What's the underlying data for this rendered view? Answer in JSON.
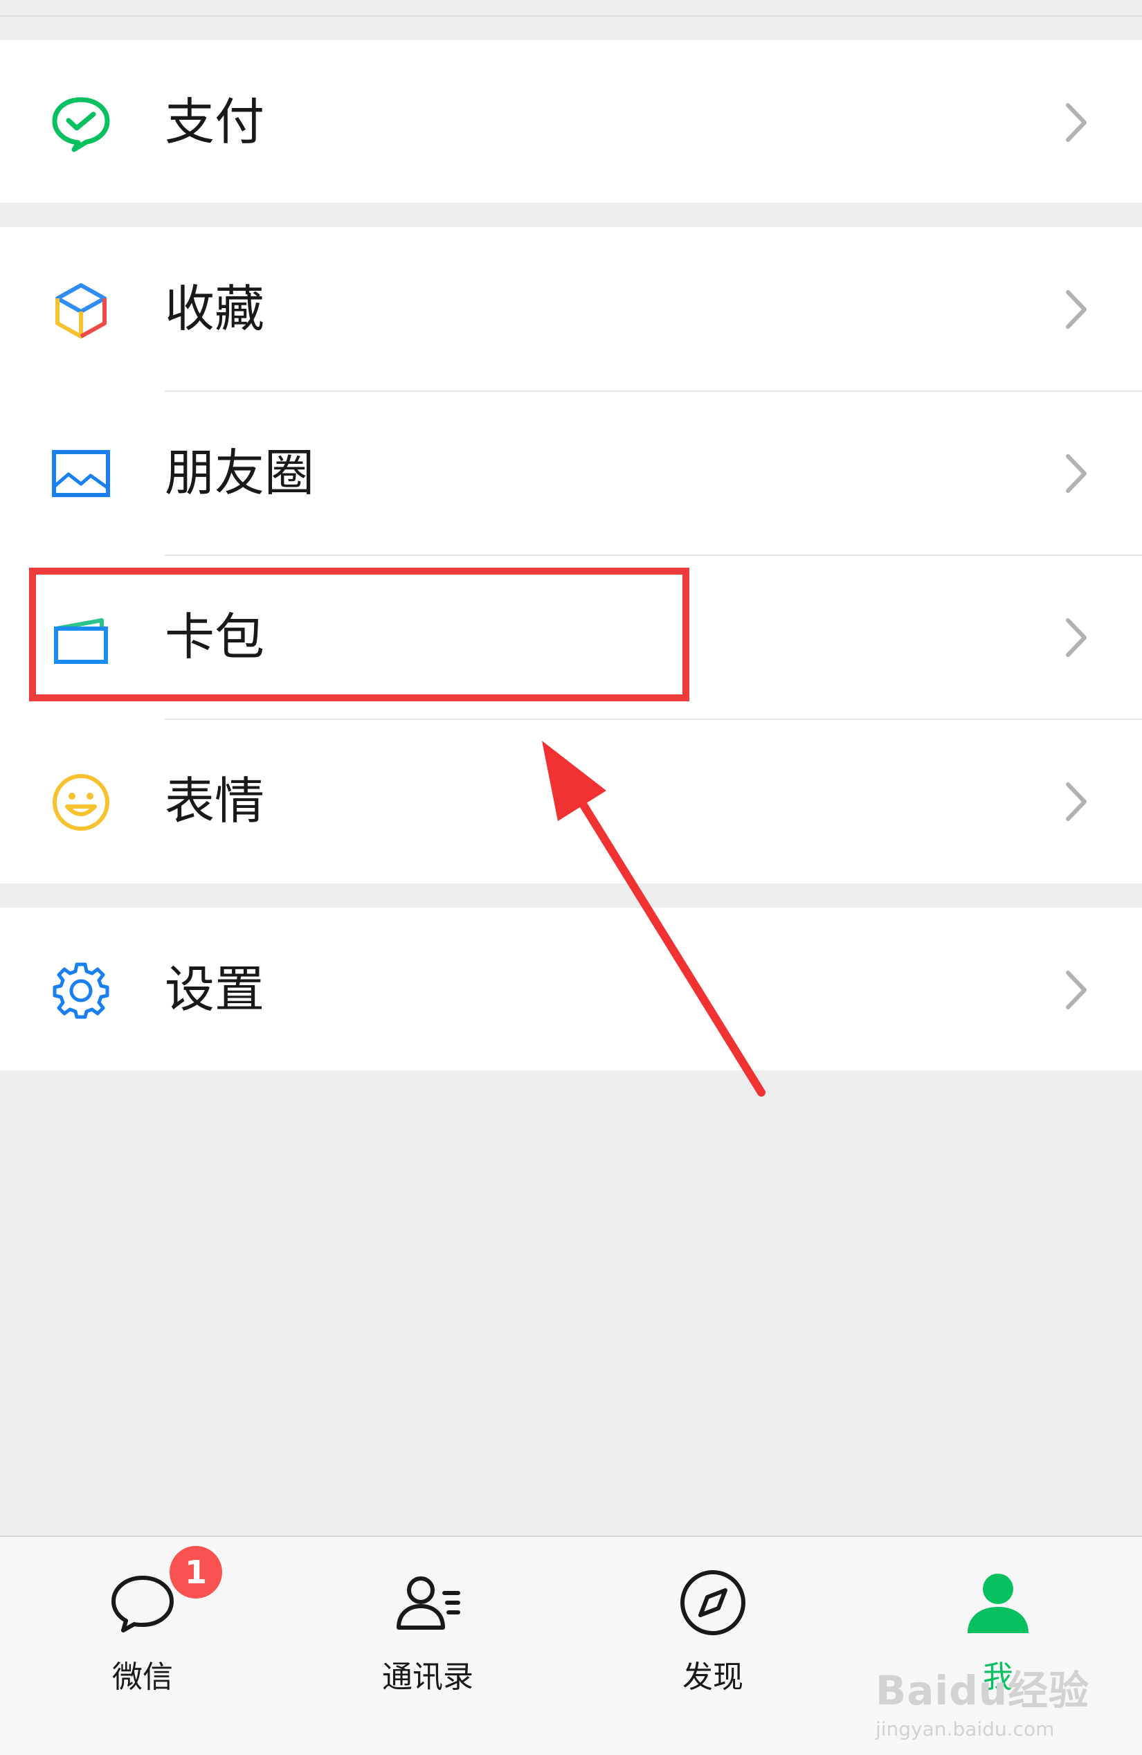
{
  "menu_groups": [
    {
      "items": [
        {
          "label": "支付",
          "icon": "wechat-pay-icon"
        }
      ]
    },
    {
      "items": [
        {
          "label": "收藏",
          "icon": "favorites-cube-icon"
        },
        {
          "label": "朋友圈",
          "icon": "moments-picture-icon"
        },
        {
          "label": "卡包",
          "icon": "card-wallet-icon"
        },
        {
          "label": "表情",
          "icon": "emoji-smile-icon"
        }
      ]
    },
    {
      "items": [
        {
          "label": "设置",
          "icon": "settings-gear-icon"
        }
      ]
    }
  ],
  "tabbar": {
    "tabs": [
      {
        "label": "微信",
        "icon": "chat-bubble-icon",
        "badge": "1"
      },
      {
        "label": "通讯录",
        "icon": "contacts-icon"
      },
      {
        "label": "发现",
        "icon": "compass-icon"
      },
      {
        "label": "我",
        "icon": "me-person-icon",
        "active": true
      }
    ]
  },
  "annotation": {
    "highlight_target": "卡包",
    "color": "#ef3b3b"
  },
  "watermark": {
    "brand": "Baidu经验",
    "url": "jingyan.baidu.com"
  },
  "colors": {
    "background": "#ededed",
    "row_background": "#ffffff",
    "text": "#191919",
    "accent_green": "#07c160",
    "chevron": "#b2b2b2",
    "badge": "#fa5151"
  }
}
